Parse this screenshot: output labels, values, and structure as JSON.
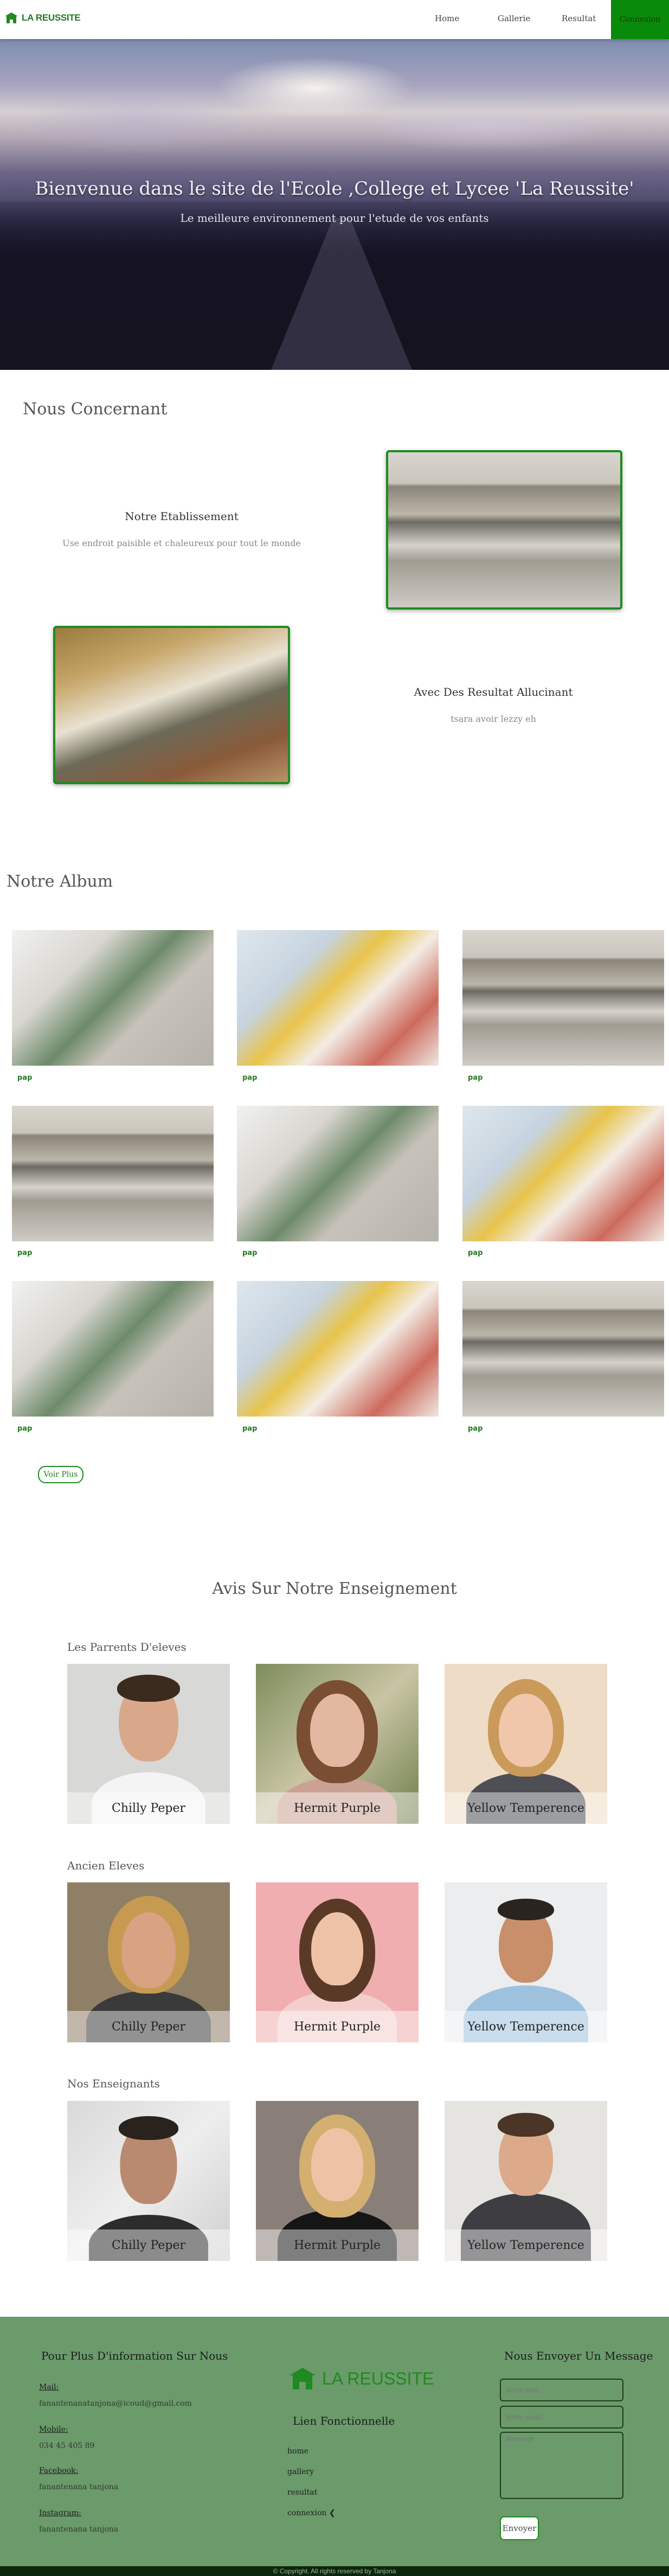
{
  "nav": {
    "brand": "LA REUSSITE",
    "links": {
      "home": "Home",
      "gallerie": "Gallerie",
      "resultat": "Resultat"
    },
    "connexion": "Connexion"
  },
  "hero": {
    "title": "Bienvenue dans le site de l'Ecole ,College et Lycee 'La Reussite'",
    "subtitle": "Le meilleure environnement pour l'etude de vos enfants"
  },
  "about": {
    "heading": "Nous Concernant",
    "block1": {
      "title": "Notre Etablissement",
      "text": "Use endroit paisible et chaleureux pour tout le monde"
    },
    "block2": {
      "title": "Avec Des Resultat Allucinant",
      "text": "tsara avoir lezzy eh"
    }
  },
  "album": {
    "heading": "Notre Album",
    "items": [
      {
        "caption": "pap"
      },
      {
        "caption": "pap"
      },
      {
        "caption": "pap"
      },
      {
        "caption": "pap"
      },
      {
        "caption": "pap"
      },
      {
        "caption": "pap"
      },
      {
        "caption": "pap"
      },
      {
        "caption": "pap"
      },
      {
        "caption": "pap"
      }
    ],
    "more": "Voir Plus"
  },
  "avis": {
    "heading": "Avis Sur Notre Enseignement",
    "groups": [
      {
        "title": "Les Parrents D'eleves",
        "people": [
          "Chilly Peper",
          "Hermit Purple",
          "Yellow Temperence"
        ]
      },
      {
        "title": "Ancien Eleves",
        "people": [
          "Chilly Peper",
          "Hermit Purple",
          "Yellow Temperence"
        ]
      },
      {
        "title": "Nos Enseignants",
        "people": [
          "Chilly Peper",
          "Hermit Purple",
          "Yellow Temperence"
        ]
      }
    ]
  },
  "footer": {
    "info_title": "Pour Plus D'information Sur Nous",
    "mail_label": "Mail:",
    "mail_value": "fanantenanatanjona@icoud@gmail.com",
    "mobile_label": "Mobile:",
    "mobile_value": "034 45 405 89",
    "facebook_label": "Facebook:",
    "facebook_value": "fanantenana tanjona",
    "instagram_label": "Instagram:",
    "instagram_value": "fanantenana tanjona",
    "brand": "LA REUSSITE",
    "links_title": "Lien Fonctionnelle",
    "links": [
      "home",
      "gallery",
      "resultat",
      "connexion"
    ],
    "message_title": "Nous Envoyer Un Message",
    "name_placeholder": "Votre nom",
    "email_placeholder": "Votre email",
    "message_placeholder": "Message",
    "send": "Envoyer",
    "copyright": "© Copyright. All rights reserved by Tanjona"
  },
  "colors": {
    "accent": "#1f8a1f",
    "footer_bg": "#6b9a6b",
    "nav_button": "#0a8a0a"
  }
}
